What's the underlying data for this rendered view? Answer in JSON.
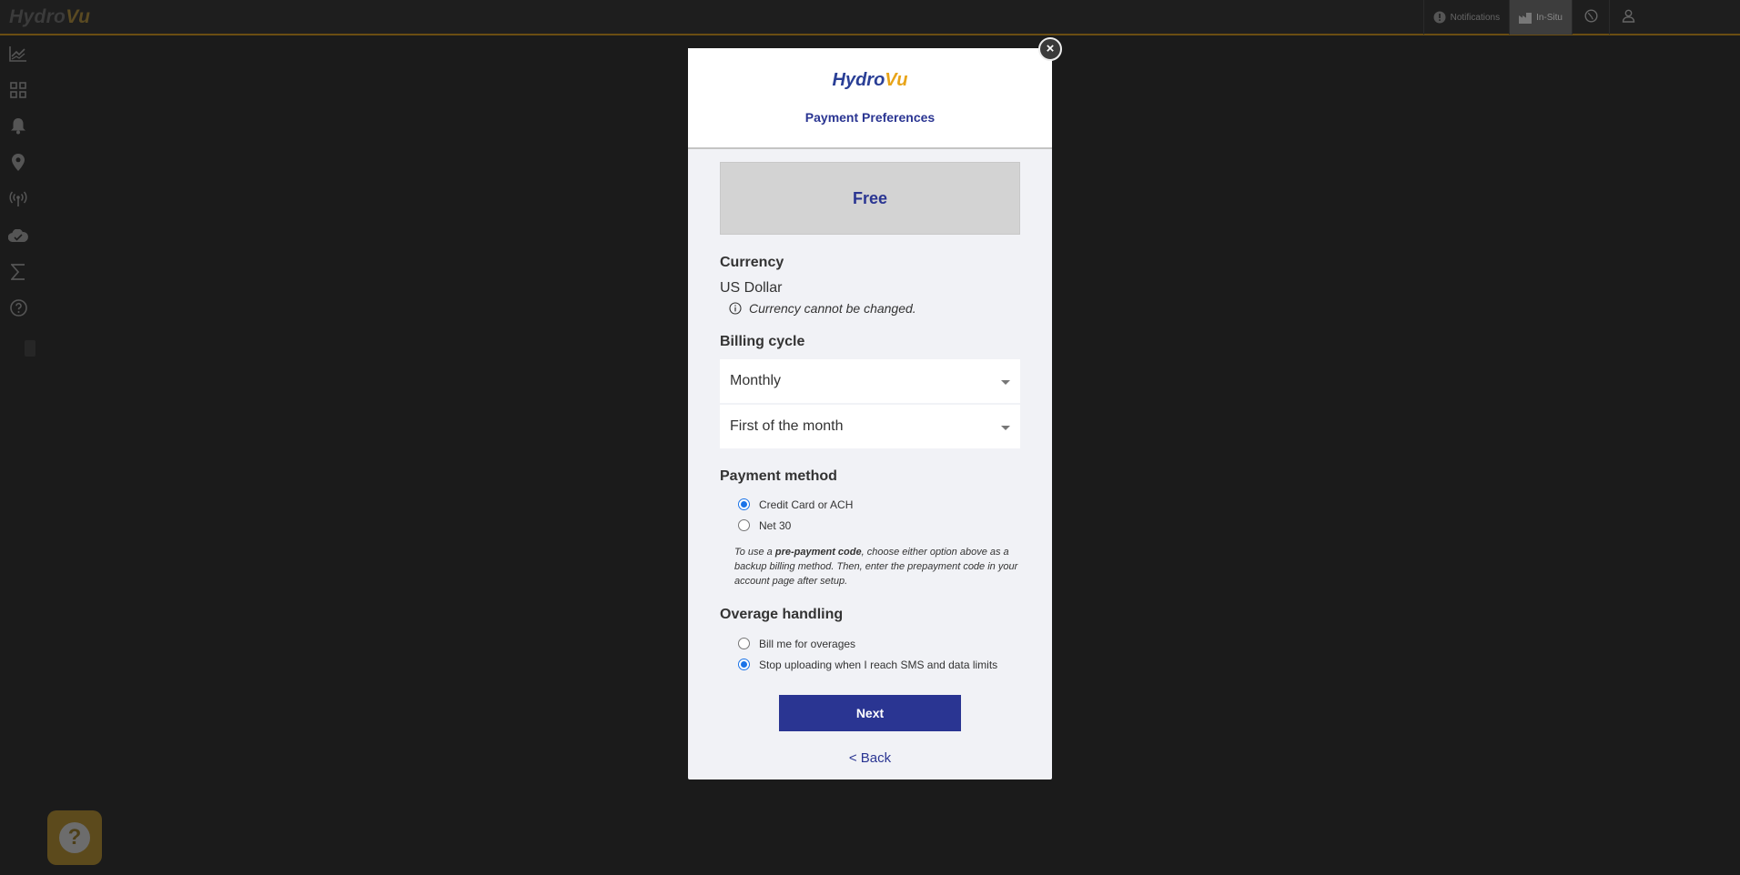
{
  "app": {
    "brand_hydro": "Hydro",
    "brand_vu": "Vu"
  },
  "topbar": {
    "notifications_label": "Notifications",
    "insitu_label": "In-Situ",
    "icons": [
      "notification-icon",
      "building-icon",
      "globe-icon",
      "user-icon"
    ]
  },
  "sidebar": {
    "items": [
      "chart-icon",
      "dashboard-icon",
      "bell-icon",
      "location-icon",
      "antenna-icon",
      "cloud-icon",
      "sigma-icon",
      "help-icon"
    ]
  },
  "modal": {
    "logo_hydro": "Hydro",
    "logo_vu": "Vu",
    "title": "Payment Preferences",
    "close_label": "×",
    "plan_name": "Free",
    "currency": {
      "label": "Currency",
      "value": "US Dollar",
      "note": "Currency cannot be changed."
    },
    "billing": {
      "label": "Billing cycle",
      "cycle_value": "Monthly",
      "day_value": "First of the month"
    },
    "payment": {
      "label": "Payment method",
      "options": [
        "Credit Card or ACH",
        "Net 30"
      ],
      "selected": 0,
      "note_prefix": "To use a ",
      "note_bold": "pre-payment code",
      "note_suffix": ", choose either option above as a backup billing method. Then, enter the prepayment code in your account page after setup."
    },
    "overage": {
      "label": "Overage handling",
      "options": [
        "Bill me for overages",
        "Stop uploading when I reach SMS and data limits"
      ],
      "selected": 1
    },
    "next_label": "Next",
    "back_label": "< Back"
  },
  "colors": {
    "primary": "#2a3592",
    "accent": "#e8a418",
    "radio_checked": "#1a73e8",
    "backdrop": "#1b1b1b"
  }
}
